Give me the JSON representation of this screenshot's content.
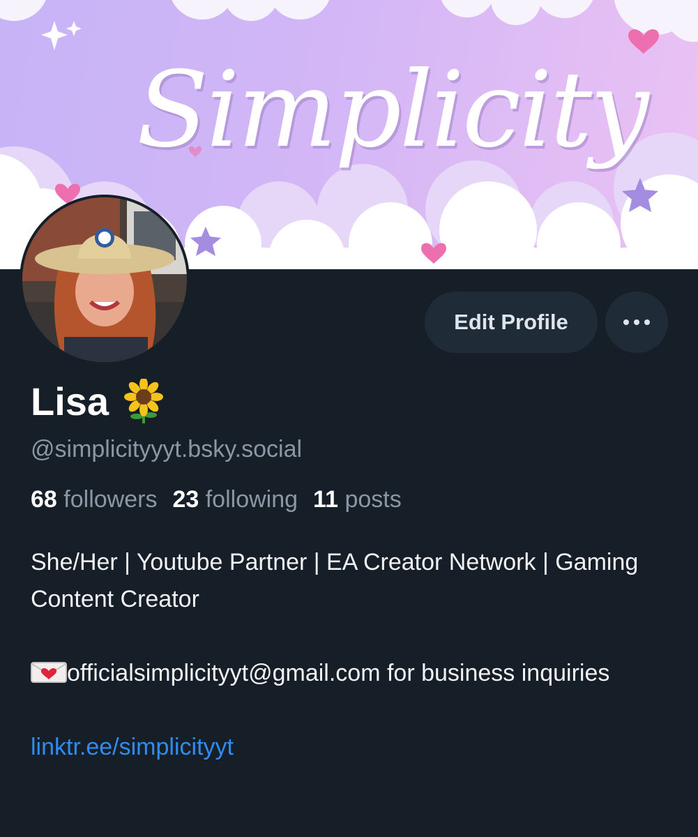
{
  "banner": {
    "title": "Simplicity",
    "colors": {
      "sky_start": "#c6b4f7",
      "sky_end": "#ebc2f3",
      "heart": "#ee6fb0",
      "star": "#a48de0"
    }
  },
  "profile": {
    "name": "Lisa",
    "name_emoji_icon": "sunflower-icon",
    "handle": "@simplicityyyt.bsky.social",
    "avatar_icon": "avatar-photo"
  },
  "actions": {
    "edit_label": "Edit Profile",
    "more_icon": "ellipsis-icon"
  },
  "stats": {
    "followers_count": "68",
    "followers_label": "followers",
    "following_count": "23",
    "following_label": "following",
    "posts_count": "11",
    "posts_label": "posts"
  },
  "bio": {
    "line1": "She/Her | Youtube Partner | EA Creator Network | Gaming Content Creator",
    "email_icon": "love-letter-icon",
    "line2": "officialsimplicityyt@gmail.com for business inquiries",
    "link": "linktr.ee/simplicityyt"
  },
  "colors": {
    "background": "#161e27",
    "button_bg": "#1f2b37",
    "muted_text": "#8b97a5",
    "link": "#2f8cf1"
  }
}
